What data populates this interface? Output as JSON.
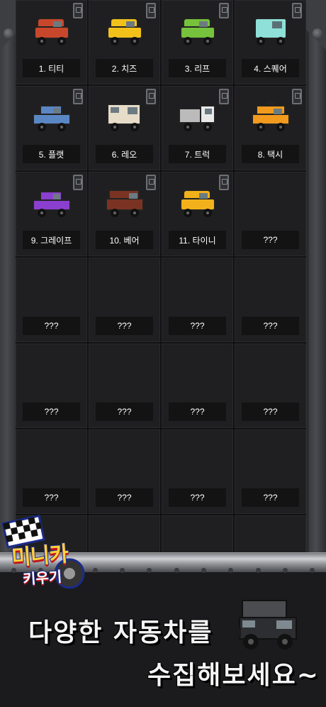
{
  "cars": [
    {
      "label": "1. 티티",
      "color": "#c8472c",
      "type": "hatch",
      "locked": true
    },
    {
      "label": "2. 치즈",
      "color": "#f2c21b",
      "type": "hatch",
      "locked": true
    },
    {
      "label": "3. 리프",
      "color": "#76c23c",
      "type": "hatch",
      "locked": true
    },
    {
      "label": "4. 스퀘어",
      "color": "#8ee0d8",
      "type": "box",
      "locked": true
    },
    {
      "label": "5. 플랫",
      "color": "#5a87c4",
      "type": "sedan",
      "locked": true
    },
    {
      "label": "6. 레오",
      "color": "#e6dcc8",
      "type": "van",
      "locked": true
    },
    {
      "label": "7. 트럭",
      "color": "#e9e9e9",
      "type": "truck",
      "locked": true
    },
    {
      "label": "8. 택시",
      "color": "#f29a1d",
      "type": "taxi",
      "locked": true
    },
    {
      "label": "9. 그레이프",
      "color": "#8b3fcf",
      "type": "sedan",
      "locked": true
    },
    {
      "label": "10. 베어",
      "color": "#7a3323",
      "type": "suv",
      "locked": true
    },
    {
      "label": "11. 타이니",
      "color": "#f2b11b",
      "type": "hatch",
      "locked": true
    },
    {
      "label": "???",
      "locked": false
    },
    {
      "label": "???",
      "locked": false
    },
    {
      "label": "???",
      "locked": false
    },
    {
      "label": "???",
      "locked": false
    },
    {
      "label": "???",
      "locked": false
    },
    {
      "label": "???",
      "locked": false
    },
    {
      "label": "???",
      "locked": false
    },
    {
      "label": "???",
      "locked": false
    },
    {
      "label": "???",
      "locked": false
    },
    {
      "label": "???",
      "locked": false
    },
    {
      "label": "???",
      "locked": false
    },
    {
      "label": "???",
      "locked": false
    },
    {
      "label": "???",
      "locked": false
    },
    {
      "label": "",
      "locked": false
    },
    {
      "label": "",
      "locked": false
    },
    {
      "label": "",
      "locked": false
    },
    {
      "label": "",
      "locked": false
    }
  ],
  "logo": {
    "main": "미니카",
    "sub": "키우기"
  },
  "slogan": {
    "line1": "다양한 자동차를",
    "line2": "수집해보세요~"
  },
  "colors": {
    "accent": "#ffd23a",
    "logo_outline": "#1b2b8a",
    "logo_shadow": "#c0171d"
  }
}
